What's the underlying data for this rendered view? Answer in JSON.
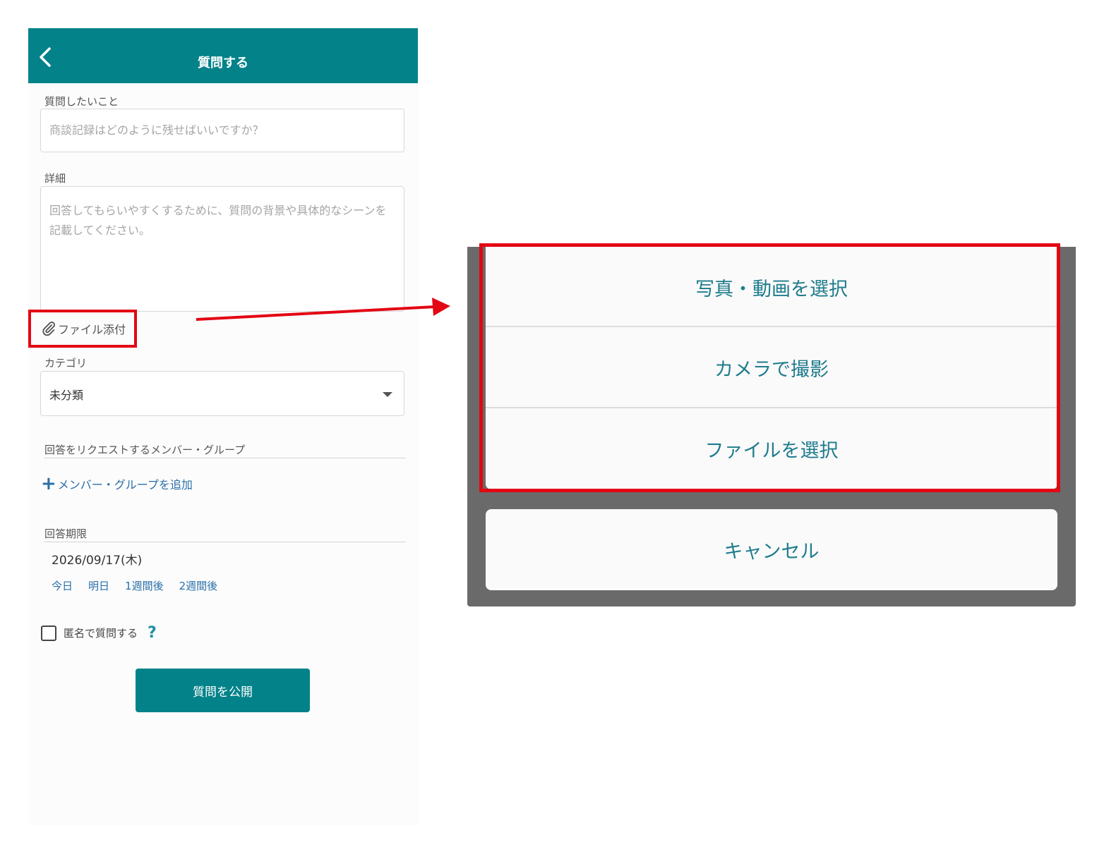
{
  "form_screen": {
    "header": {
      "title": "質問する"
    },
    "question": {
      "label": "質問したいこと",
      "placeholder": "商談記録はどのように残せばいいですか？"
    },
    "details": {
      "label": "詳細",
      "placeholder": "回答してもらいやすくするために、質問の背景や具体的なシーンを記載してください。"
    },
    "attachment": {
      "label": "ファイル添付",
      "icon": "paperclip-icon"
    },
    "category": {
      "label": "カテゴリ",
      "value": "未分類"
    },
    "request": {
      "label": "回答をリクエストするメンバー・グループ",
      "add_label": "メンバー・グループを追加",
      "add_icon": "+"
    },
    "deadline": {
      "label": "回答期限",
      "value": "2026/09/17(木)",
      "quick": [
        "今日",
        "明日",
        "1週間後",
        "2週間後"
      ]
    },
    "anonymous": {
      "label": "匿名で質問する",
      "help": "?"
    },
    "submit_label": "質問を公開"
  },
  "action_sheet": {
    "options": [
      "写真・動画を選択",
      "カメラで撮影",
      "ファイルを選択"
    ],
    "cancel": "キャンセル"
  },
  "colors": {
    "brand": "#03828a",
    "highlight": "#e30613",
    "link": "#2a6fa8",
    "sheet_text": "#1f7c8c",
    "sheet_backdrop": "#6a6a6a"
  }
}
